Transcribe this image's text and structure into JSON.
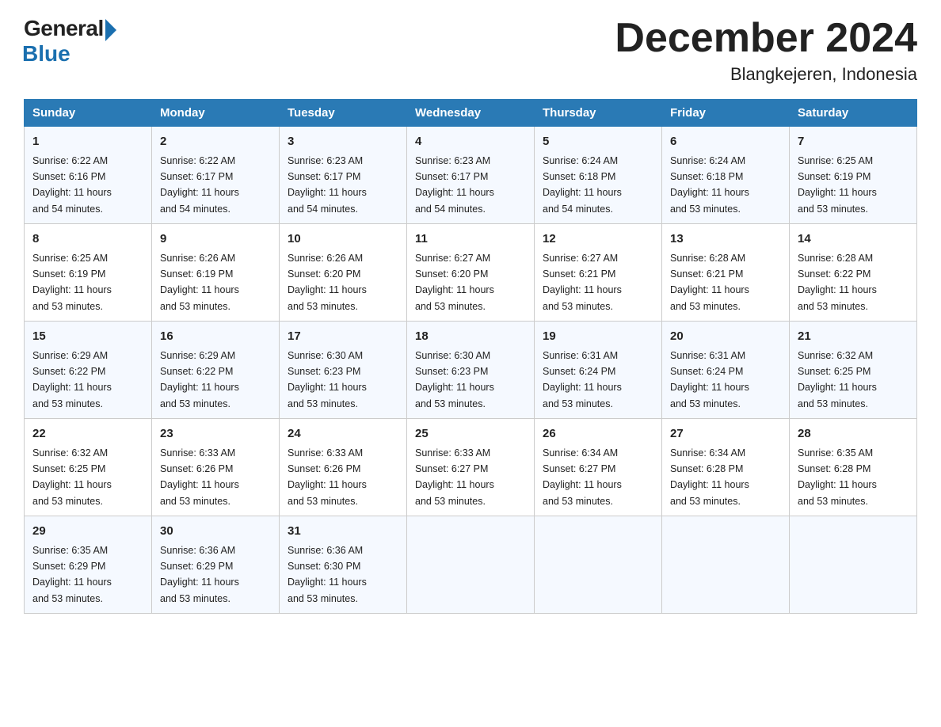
{
  "header": {
    "logo_general": "General",
    "logo_blue": "Blue",
    "title": "December 2024",
    "subtitle": "Blangkejeren, Indonesia"
  },
  "days_of_week": [
    "Sunday",
    "Monday",
    "Tuesday",
    "Wednesday",
    "Thursday",
    "Friday",
    "Saturday"
  ],
  "weeks": [
    [
      {
        "day": "1",
        "sunrise": "6:22 AM",
        "sunset": "6:16 PM",
        "daylight": "11 hours and 54 minutes."
      },
      {
        "day": "2",
        "sunrise": "6:22 AM",
        "sunset": "6:17 PM",
        "daylight": "11 hours and 54 minutes."
      },
      {
        "day": "3",
        "sunrise": "6:23 AM",
        "sunset": "6:17 PM",
        "daylight": "11 hours and 54 minutes."
      },
      {
        "day": "4",
        "sunrise": "6:23 AM",
        "sunset": "6:17 PM",
        "daylight": "11 hours and 54 minutes."
      },
      {
        "day": "5",
        "sunrise": "6:24 AM",
        "sunset": "6:18 PM",
        "daylight": "11 hours and 54 minutes."
      },
      {
        "day": "6",
        "sunrise": "6:24 AM",
        "sunset": "6:18 PM",
        "daylight": "11 hours and 53 minutes."
      },
      {
        "day": "7",
        "sunrise": "6:25 AM",
        "sunset": "6:19 PM",
        "daylight": "11 hours and 53 minutes."
      }
    ],
    [
      {
        "day": "8",
        "sunrise": "6:25 AM",
        "sunset": "6:19 PM",
        "daylight": "11 hours and 53 minutes."
      },
      {
        "day": "9",
        "sunrise": "6:26 AM",
        "sunset": "6:19 PM",
        "daylight": "11 hours and 53 minutes."
      },
      {
        "day": "10",
        "sunrise": "6:26 AM",
        "sunset": "6:20 PM",
        "daylight": "11 hours and 53 minutes."
      },
      {
        "day": "11",
        "sunrise": "6:27 AM",
        "sunset": "6:20 PM",
        "daylight": "11 hours and 53 minutes."
      },
      {
        "day": "12",
        "sunrise": "6:27 AM",
        "sunset": "6:21 PM",
        "daylight": "11 hours and 53 minutes."
      },
      {
        "day": "13",
        "sunrise": "6:28 AM",
        "sunset": "6:21 PM",
        "daylight": "11 hours and 53 minutes."
      },
      {
        "day": "14",
        "sunrise": "6:28 AM",
        "sunset": "6:22 PM",
        "daylight": "11 hours and 53 minutes."
      }
    ],
    [
      {
        "day": "15",
        "sunrise": "6:29 AM",
        "sunset": "6:22 PM",
        "daylight": "11 hours and 53 minutes."
      },
      {
        "day": "16",
        "sunrise": "6:29 AM",
        "sunset": "6:22 PM",
        "daylight": "11 hours and 53 minutes."
      },
      {
        "day": "17",
        "sunrise": "6:30 AM",
        "sunset": "6:23 PM",
        "daylight": "11 hours and 53 minutes."
      },
      {
        "day": "18",
        "sunrise": "6:30 AM",
        "sunset": "6:23 PM",
        "daylight": "11 hours and 53 minutes."
      },
      {
        "day": "19",
        "sunrise": "6:31 AM",
        "sunset": "6:24 PM",
        "daylight": "11 hours and 53 minutes."
      },
      {
        "day": "20",
        "sunrise": "6:31 AM",
        "sunset": "6:24 PM",
        "daylight": "11 hours and 53 minutes."
      },
      {
        "day": "21",
        "sunrise": "6:32 AM",
        "sunset": "6:25 PM",
        "daylight": "11 hours and 53 minutes."
      }
    ],
    [
      {
        "day": "22",
        "sunrise": "6:32 AM",
        "sunset": "6:25 PM",
        "daylight": "11 hours and 53 minutes."
      },
      {
        "day": "23",
        "sunrise": "6:33 AM",
        "sunset": "6:26 PM",
        "daylight": "11 hours and 53 minutes."
      },
      {
        "day": "24",
        "sunrise": "6:33 AM",
        "sunset": "6:26 PM",
        "daylight": "11 hours and 53 minutes."
      },
      {
        "day": "25",
        "sunrise": "6:33 AM",
        "sunset": "6:27 PM",
        "daylight": "11 hours and 53 minutes."
      },
      {
        "day": "26",
        "sunrise": "6:34 AM",
        "sunset": "6:27 PM",
        "daylight": "11 hours and 53 minutes."
      },
      {
        "day": "27",
        "sunrise": "6:34 AM",
        "sunset": "6:28 PM",
        "daylight": "11 hours and 53 minutes."
      },
      {
        "day": "28",
        "sunrise": "6:35 AM",
        "sunset": "6:28 PM",
        "daylight": "11 hours and 53 minutes."
      }
    ],
    [
      {
        "day": "29",
        "sunrise": "6:35 AM",
        "sunset": "6:29 PM",
        "daylight": "11 hours and 53 minutes."
      },
      {
        "day": "30",
        "sunrise": "6:36 AM",
        "sunset": "6:29 PM",
        "daylight": "11 hours and 53 minutes."
      },
      {
        "day": "31",
        "sunrise": "6:36 AM",
        "sunset": "6:30 PM",
        "daylight": "11 hours and 53 minutes."
      },
      null,
      null,
      null,
      null
    ]
  ],
  "labels": {
    "sunrise": "Sunrise:",
    "sunset": "Sunset:",
    "daylight": "Daylight:"
  }
}
